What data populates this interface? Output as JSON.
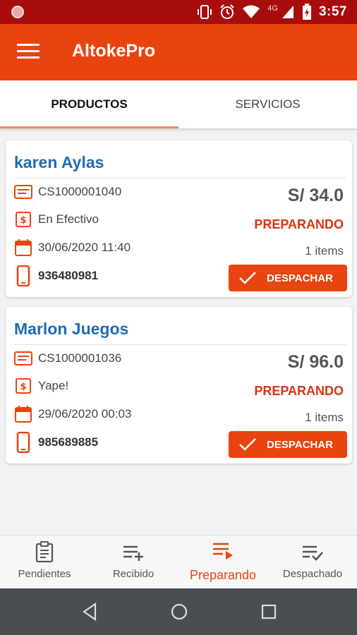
{
  "status_bar": {
    "time": "3:57",
    "network": "4G",
    "icons": [
      "vibrate-icon",
      "alarm-icon",
      "wifi-icon",
      "signal-icon",
      "battery-icon"
    ]
  },
  "app_bar": {
    "title": "AltokePro"
  },
  "tabs": [
    {
      "label": "PRODUCTOS",
      "active": true
    },
    {
      "label": "SERVICIOS",
      "active": false
    }
  ],
  "orders": [
    {
      "customer": "karen Aylas",
      "code": "CS1000001040",
      "payment": "En Efectivo",
      "datetime": "30/06/2020 11:40",
      "phone": "936480981",
      "price": "S/ 34.0",
      "status": "PREPARANDO",
      "items": "1 items",
      "action_label": "DESPACHAR"
    },
    {
      "customer": "Marlon Juegos",
      "code": "CS1000001036",
      "payment": "Yape!",
      "datetime": "29/06/2020 00:03",
      "phone": "985689885",
      "price": "S/ 96.0",
      "status": "PREPARANDO",
      "items": "1 items",
      "action_label": "DESPACHAR"
    }
  ],
  "bottom_nav": [
    {
      "label": "Pendientes",
      "icon": "clipboard-icon",
      "active": false
    },
    {
      "label": "Recibido",
      "icon": "list-add-icon",
      "active": false
    },
    {
      "label": "Preparando",
      "icon": "list-play-icon",
      "active": true
    },
    {
      "label": "Despachado",
      "icon": "list-check-icon",
      "active": false
    }
  ],
  "colors": {
    "status_bar": "#a80d0d",
    "primary": "#e8440f",
    "customer_name": "#1f6cb0",
    "status_text": "#d8340f"
  }
}
